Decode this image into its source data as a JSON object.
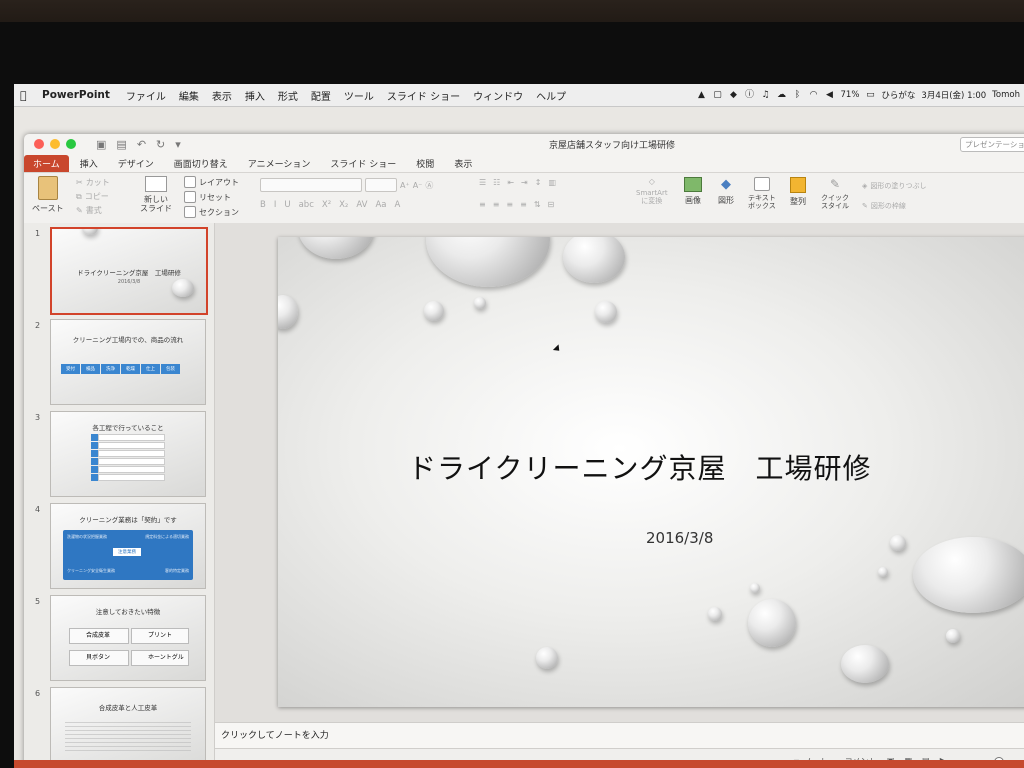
{
  "menubar": {
    "app": "PowerPoint",
    "items": [
      "ファイル",
      "編集",
      "表示",
      "挿入",
      "形式",
      "配置",
      "ツール",
      "スライド ショー",
      "ウィンドウ",
      "ヘルプ"
    ],
    "battery": "71%",
    "input_method": "ひらがな",
    "datetime": "3月4日(金) 1:00",
    "user": "Tomoh"
  },
  "window": {
    "title": "京屋店舗スタッフ向け工場研修",
    "search_placeholder": "プレゼンテーション"
  },
  "tabs": [
    "ホーム",
    "挿入",
    "デザイン",
    "画面切り替え",
    "アニメーション",
    "スライド ショー",
    "校閲",
    "表示"
  ],
  "ribbon": {
    "paste": "ペースト",
    "cut": "カット",
    "copy": "コピー",
    "format": "書式",
    "new_slide": "新しい\nスライド",
    "layout": "レイアウト",
    "reset": "リセット",
    "section": "セクション",
    "smartart": "SmartArt\nに変換",
    "picture": "画像",
    "shapes": "図形",
    "textbox": "テキスト\nボックス",
    "arrange": "整列",
    "quick_styles": "クイック\nスタイル",
    "shape_fill": "図形の塗りつぶし",
    "shape_outline": "図形の枠線"
  },
  "slides": [
    {
      "num": "1",
      "title": "ドライクリーニング京屋　工場研修",
      "sub": "2016/3/8"
    },
    {
      "num": "2",
      "title": "クリーニング工場内での、商品の流れ",
      "steps": [
        "受付",
        "検品",
        "洗浄",
        "乾燥",
        "仕上",
        "包装"
      ]
    },
    {
      "num": "3",
      "title": "各工程で行っていること"
    },
    {
      "num": "4",
      "title": "クリーニング業務は「契約」です",
      "left1": "洗濯物の状況把握業務",
      "right1": "規定料金による適切業務",
      "center": "注意業務",
      "left2": "クリーニング安全衛生業務",
      "right2": "客的特定業務"
    },
    {
      "num": "5",
      "title": "注意しておきたい特徴",
      "items": [
        "合成皮革",
        "プリント",
        "貝ボタン",
        "ホーントグル"
      ]
    },
    {
      "num": "6",
      "title": "合成皮革と人工皮革"
    }
  ],
  "main_slide": {
    "title": "ドライクリーニング京屋　工場研修",
    "subtitle": "2016/3/8"
  },
  "notes_placeholder": "クリックしてノートを入力",
  "status": {
    "notes": "ノート",
    "comments": "コメント"
  },
  "colors": {
    "accent": "#c9472d",
    "selection": "#d2432a",
    "slide4_panel": "#2f77c2",
    "slide2_arrow": "#3a86d0"
  }
}
